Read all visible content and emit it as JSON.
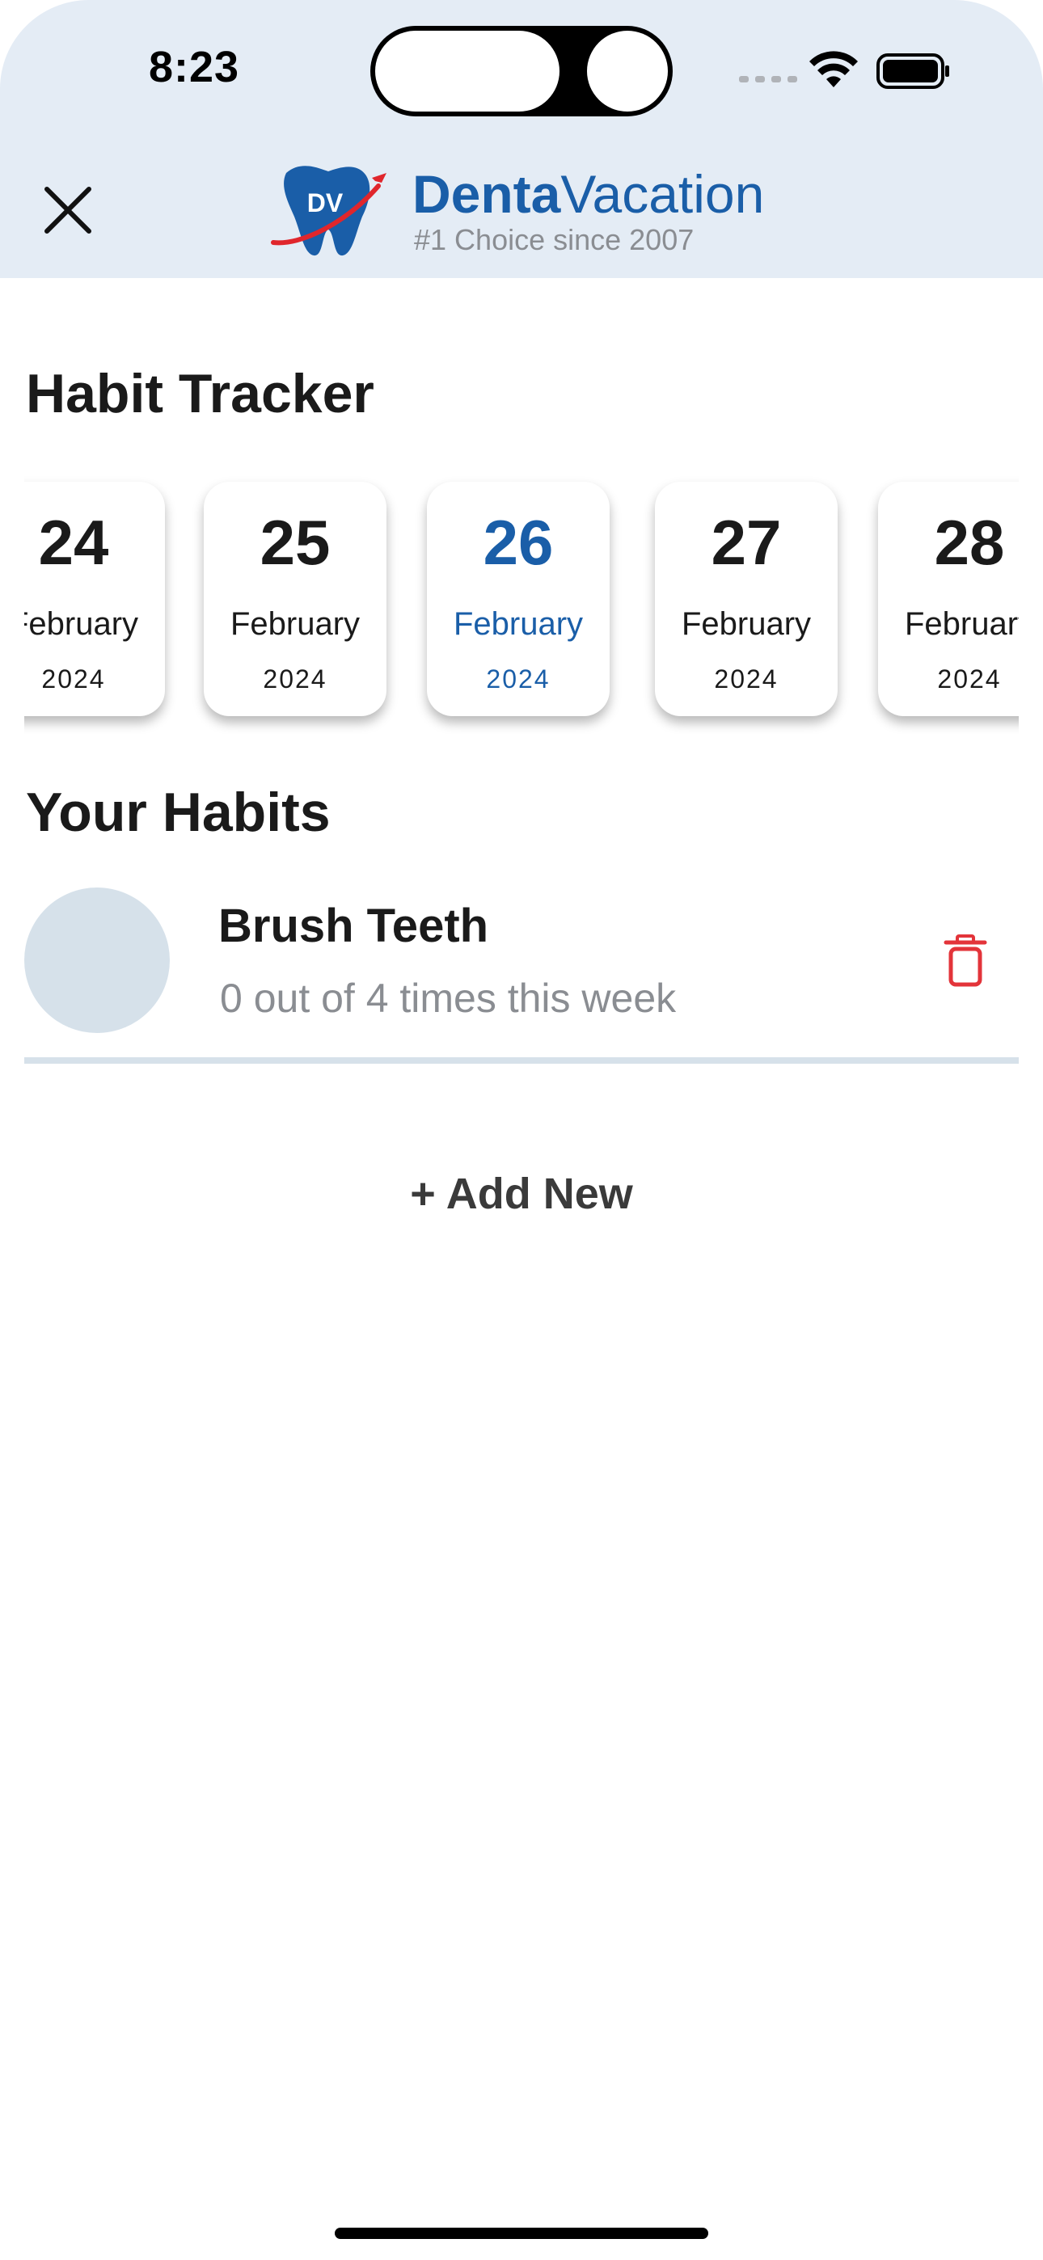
{
  "status_bar": {
    "time": "8:23"
  },
  "header": {
    "brand_bold": "Denta",
    "brand_light": "Vacation",
    "tagline": "#1 Choice since 2007",
    "logo_text": "DV",
    "accent_color": "#1a5ea8"
  },
  "tracker": {
    "title": "Habit Tracker",
    "days": [
      {
        "day": "24",
        "month": "February",
        "year": "2024"
      },
      {
        "day": "25",
        "month": "February",
        "year": "2024"
      },
      {
        "day": "26",
        "month": "February",
        "year": "2024",
        "selected": true
      },
      {
        "day": "27",
        "month": "February",
        "year": "2024"
      },
      {
        "day": "28",
        "month": "February",
        "year": "2024"
      }
    ]
  },
  "habits": {
    "title": "Your Habits",
    "items": [
      {
        "name": "Brush Teeth",
        "progress": "0 out of 4 times this week"
      }
    ],
    "add_label": "+ Add New"
  }
}
